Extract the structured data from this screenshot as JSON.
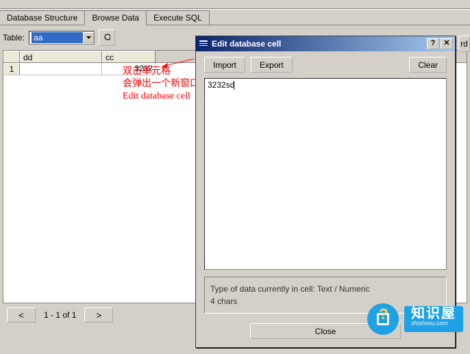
{
  "tabs": {
    "t0": "Database Structure",
    "t1": "Browse Data",
    "t2": "Execute SQL"
  },
  "table_label": "Table:",
  "table_selected": "aa",
  "grid": {
    "headers": {
      "c1": "dd",
      "c2": "cc"
    },
    "row": {
      "num": "1",
      "c1": "",
      "c2": "3232"
    }
  },
  "annotation": {
    "l1": "双击单元格",
    "l2": "会弹出一个新窗口",
    "l3": "Edit database cell"
  },
  "pager": {
    "info": "1 - 1 of 1"
  },
  "dialog": {
    "title": "Edit database cell",
    "import": "Import",
    "export": "Export",
    "clear": "Clear",
    "content": "3232sd",
    "status_l1": "Type of data currently in cell: Text / Numeric",
    "status_l2": "4 chars",
    "close": "Close"
  },
  "hidden_btn": "rd",
  "logo": {
    "cn": "知识屋",
    "en": "zhishiwu.com"
  }
}
